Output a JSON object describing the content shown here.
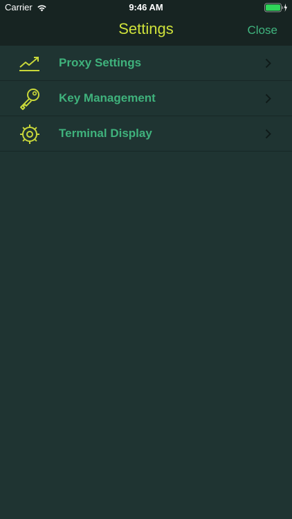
{
  "status_bar": {
    "carrier": "Carrier",
    "time": "9:46 AM",
    "wifi_icon": "wifi-icon",
    "battery_icon": "battery-charging-icon"
  },
  "nav": {
    "title": "Settings",
    "close_label": "Close"
  },
  "settings_items": [
    {
      "label": "Proxy Settings",
      "icon": "trending-up-chart-icon"
    },
    {
      "label": "Key Management",
      "icon": "key-icon"
    },
    {
      "label": "Terminal Display",
      "icon": "gear-icon"
    }
  ],
  "colors": {
    "background": "#1f3432",
    "bar_background": "#172422",
    "title": "#cfe23b",
    "accent_green": "#3fb27c",
    "icon_yellow": "#c9d83a",
    "chevron": "#0f1a19",
    "battery": "#2fd65a"
  }
}
